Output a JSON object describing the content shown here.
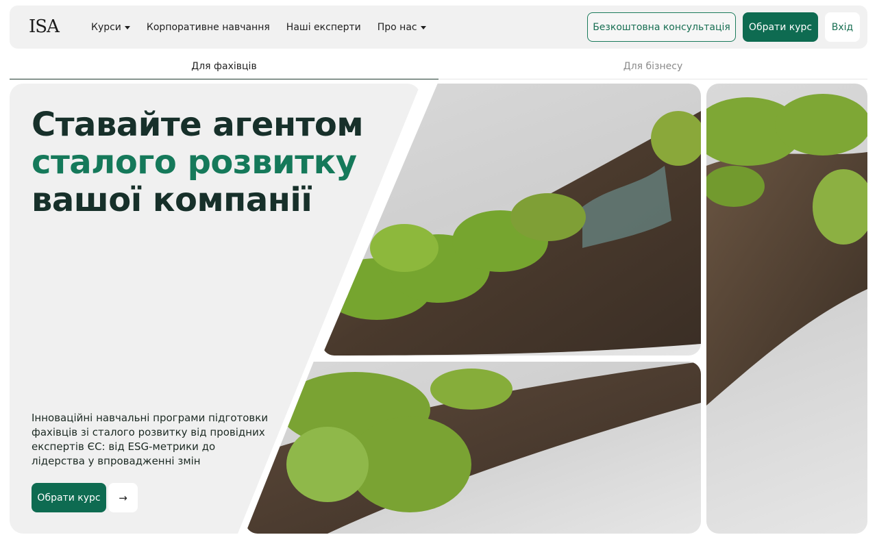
{
  "header": {
    "logo": "ISA",
    "nav": [
      {
        "label": "Курси",
        "dropdown": true
      },
      {
        "label": "Корпоративне навчання",
        "dropdown": false
      },
      {
        "label": "Наші експерти",
        "dropdown": false
      },
      {
        "label": "Про нас",
        "dropdown": true
      }
    ],
    "consult_label": "Безкоштовна консультація",
    "choose_label": "Обрати курс",
    "login_label": "Вхід"
  },
  "tabs": [
    {
      "label": "Для фахівців",
      "active": true
    },
    {
      "label": "Для бізнесу",
      "active": false
    }
  ],
  "hero": {
    "title_line1": "Ставайте агентом",
    "title_line2": "сталого розвитку",
    "title_line3": "вашої компанії",
    "description": "Інноваційні навчальні програми підготовки фахівців зі сталого розвитку від провідних експертів ЄС: від ESG-метрики до лідерства у впровадженні змін",
    "cta_label": "Обрати курс",
    "arrow_icon": "→"
  },
  "colors": {
    "accent": "#0e6b51",
    "accent_text": "#15795a",
    "panel": "#f0f0f0",
    "moss": "#6f9a2c",
    "bark": "#5a4636"
  }
}
